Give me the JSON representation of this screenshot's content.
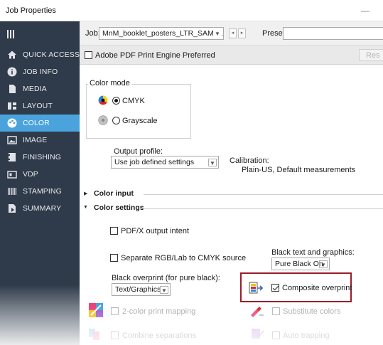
{
  "window": {
    "title": "Job Properties",
    "minimize_glyph": "—"
  },
  "sidebar": {
    "items": [
      {
        "label": "QUICK ACCESS",
        "icon": "home-icon",
        "active": false
      },
      {
        "label": "JOB INFO",
        "icon": "info-icon",
        "active": false
      },
      {
        "label": "MEDIA",
        "icon": "page-icon",
        "active": false
      },
      {
        "label": "LAYOUT",
        "icon": "layout-icon",
        "active": false
      },
      {
        "label": "COLOR",
        "icon": "color-icon",
        "active": true
      },
      {
        "label": "IMAGE",
        "icon": "image-icon",
        "active": false
      },
      {
        "label": "FINISHING",
        "icon": "finishing-icon",
        "active": false
      },
      {
        "label": "VDP",
        "icon": "vdp-icon",
        "active": false
      },
      {
        "label": "STAMPING",
        "icon": "stamping-icon",
        "active": false
      },
      {
        "label": "SUMMARY",
        "icon": "summary-icon",
        "active": false
      }
    ],
    "active_color": "#4aa3dc"
  },
  "toolbar": {
    "job_label": "Job:",
    "job_value": "MnM_booklet_posters_LTR_SAMPLE",
    "presets_label": "Presets:",
    "prev_glyph": "◂",
    "next_glyph": "▸"
  },
  "pdf_bar": {
    "label": "Adobe PDF Print Engine Preferred",
    "checked": false,
    "reset_label": "Res"
  },
  "color_mode": {
    "title": "Color mode",
    "options": [
      {
        "label": "CMYK",
        "selected": true
      },
      {
        "label": "Grayscale",
        "selected": false
      }
    ]
  },
  "output_profile": {
    "label": "Output profile:",
    "value": "Use job defined settings"
  },
  "calibration": {
    "label": "Calibration:",
    "value": "Plain-US, Default measurements"
  },
  "sections": {
    "color_input": "Color input",
    "color_settings": "Color settings"
  },
  "color_settings": {
    "pdfx_output_intent": "PDF/X output intent",
    "separate_rgb": "Separate RGB/Lab to CMYK source",
    "black_text_label": "Black text and graphics:",
    "black_text_value": "Pure Black On",
    "black_overprint_label": "Black overprint (for pure black):",
    "black_overprint_value": "Text/Graphics",
    "composite_overprint": "Composite overprint",
    "composite_overprint_checked": true,
    "two_color_mapping": "2-color print mapping",
    "substitute_colors": "Substitute colors",
    "combine_separations": "Combine separations",
    "auto_trapping": "Auto trapping"
  },
  "colors": {
    "sidebar_bg": "#2f3a4a",
    "highlight": "#9b1c2a"
  }
}
